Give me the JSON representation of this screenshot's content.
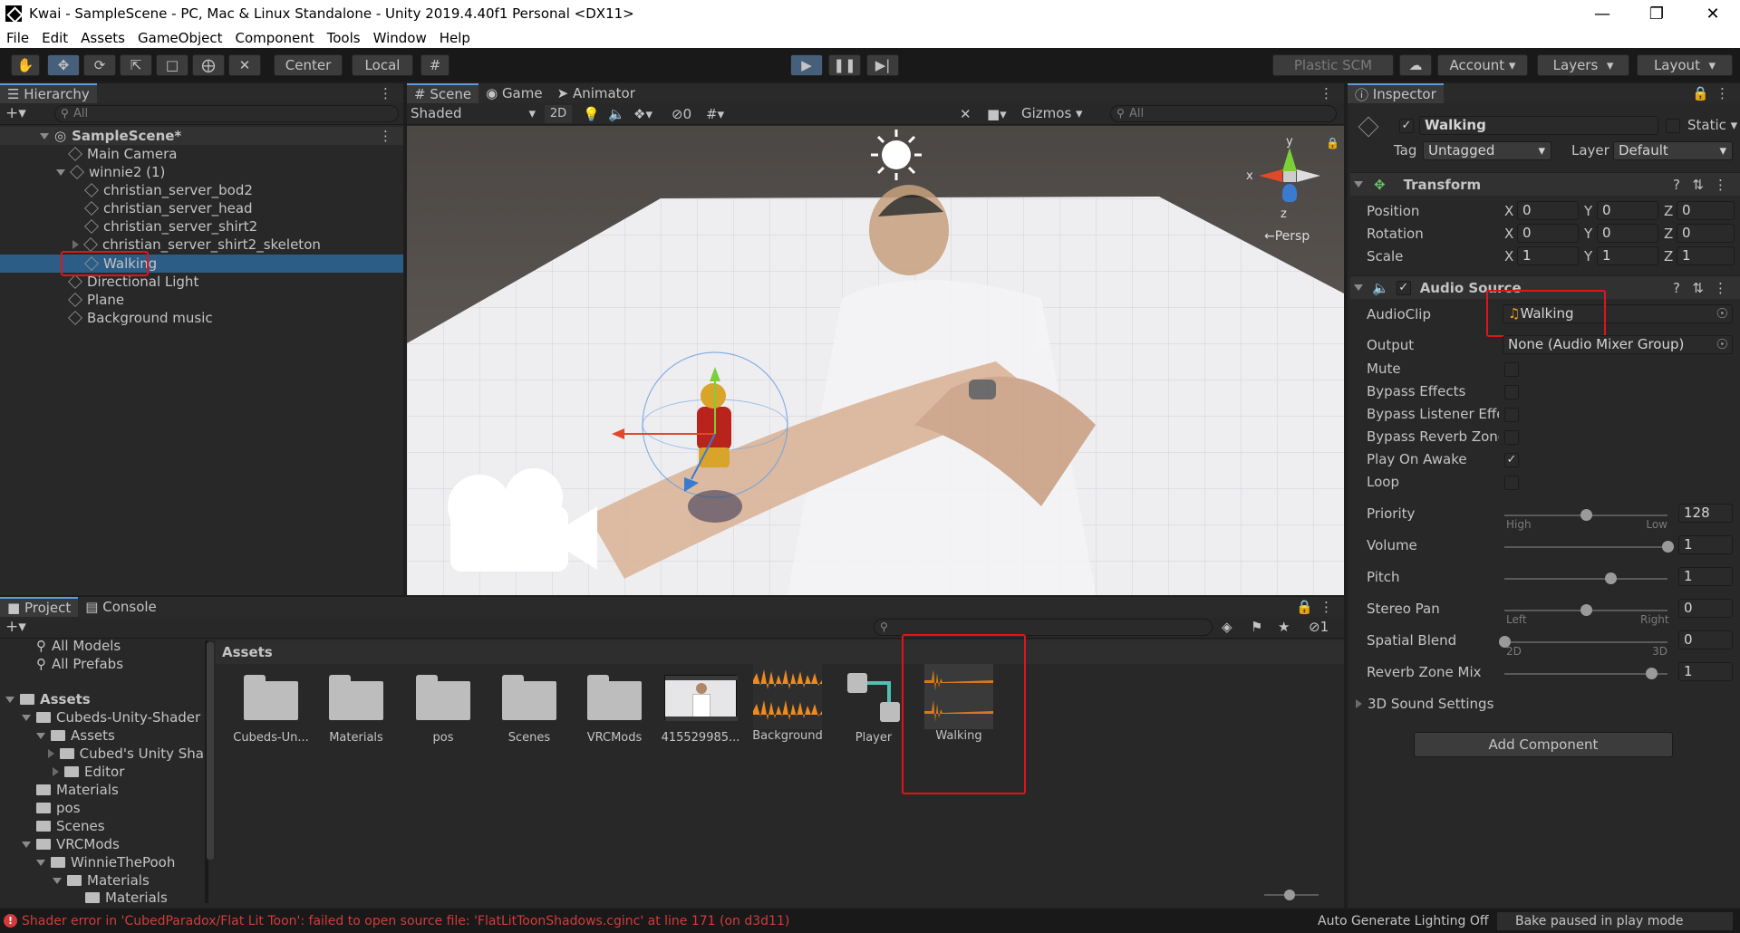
{
  "window": {
    "title": "Kwai - SampleScene - PC, Mac & Linux Standalone - Unity 2019.4.40f1 Personal <DX11>"
  },
  "menu": [
    "File",
    "Edit",
    "Assets",
    "GameObject",
    "Component",
    "Tools",
    "Window",
    "Help"
  ],
  "toolbar": {
    "pivot_label": "Center",
    "space_label": "Local",
    "plastic_label": "Plastic SCM",
    "account_label": "Account",
    "layers_label": "Layers",
    "layout_label": "Layout"
  },
  "hierarchy": {
    "tab_label": "Hierarchy",
    "search_placeholder": "All",
    "scene_name": "SampleScene*",
    "items": [
      {
        "label": "Main Camera"
      },
      {
        "label": "winnie2 (1)"
      },
      {
        "label": "christian_server_bod2"
      },
      {
        "label": "christian_server_head"
      },
      {
        "label": "christian_server_shirt2"
      },
      {
        "label": "christian_server_shirt2_skeleton"
      },
      {
        "label": "Walking"
      },
      {
        "label": "Directional Light"
      },
      {
        "label": "Plane"
      },
      {
        "label": "Background music"
      }
    ]
  },
  "scene": {
    "tabs": [
      "Scene",
      "Game",
      "Animator"
    ],
    "shading": "Shaded",
    "mode_2d": "2D",
    "hidden_count": "0",
    "gizmos_label": "Gizmos",
    "search_placeholder": "All",
    "projection": "←Persp",
    "axis_y": "y",
    "axis_x": "x",
    "axis_z": "z"
  },
  "project": {
    "tabs": [
      "Project",
      "Console"
    ],
    "tree": [
      {
        "label": "All Models"
      },
      {
        "label": "All Prefabs"
      },
      {
        "label": "Assets"
      },
      {
        "label": "Cubeds-Unity-Shader"
      },
      {
        "label": "Assets"
      },
      {
        "label": "Cubed's Unity Sha"
      },
      {
        "label": "Editor"
      },
      {
        "label": "Materials"
      },
      {
        "label": "pos"
      },
      {
        "label": "Scenes"
      },
      {
        "label": "VRCMods"
      },
      {
        "label": "WinnieThePooh"
      },
      {
        "label": "Materials"
      },
      {
        "label": "Materials"
      }
    ],
    "breadcrumb": "Assets",
    "hidden_count": "1",
    "assets": [
      {
        "label": "Cubeds-Un...",
        "kind": "folder"
      },
      {
        "label": "Materials",
        "kind": "folder"
      },
      {
        "label": "pos",
        "kind": "folder"
      },
      {
        "label": "Scenes",
        "kind": "folder"
      },
      {
        "label": "VRCMods",
        "kind": "folder"
      },
      {
        "label": "415529985...",
        "kind": "image"
      },
      {
        "label": "Background",
        "kind": "audio"
      },
      {
        "label": "Player",
        "kind": "prefab"
      },
      {
        "label": "Walking",
        "kind": "audio"
      }
    ]
  },
  "inspector": {
    "tab_label": "Inspector",
    "object_name": "Walking",
    "static_label": "Static",
    "tag_label": "Tag",
    "tag_value": "Untagged",
    "layer_label": "Layer",
    "layer_value": "Default",
    "transform": {
      "title": "Transform",
      "rows": [
        {
          "label": "Position",
          "x": "0",
          "y": "0",
          "z": "0"
        },
        {
          "label": "Rotation",
          "x": "0",
          "y": "0",
          "z": "0"
        },
        {
          "label": "Scale",
          "x": "1",
          "y": "1",
          "z": "1"
        }
      ]
    },
    "audio_source": {
      "title": "Audio Source",
      "audioclip_label": "AudioClip",
      "audioclip_value": "Walking",
      "output_label": "Output",
      "output_value": "None (Audio Mixer Group)",
      "toggles": [
        {
          "label": "Mute",
          "checked": false
        },
        {
          "label": "Bypass Effects",
          "checked": false
        },
        {
          "label": "Bypass Listener Effec",
          "checked": false
        },
        {
          "label": "Bypass Reverb Zones",
          "checked": false
        },
        {
          "label": "Play On Awake",
          "checked": true
        },
        {
          "label": "Loop",
          "checked": false
        }
      ],
      "check_mark": "✓",
      "sliders": [
        {
          "label": "Priority",
          "value": "128",
          "fraction": 0.5,
          "min_label": "High",
          "max_label": "Low"
        },
        {
          "label": "Volume",
          "value": "1",
          "fraction": 1.0,
          "min_label": "",
          "max_label": ""
        },
        {
          "label": "Pitch",
          "value": "1",
          "fraction": 0.65,
          "min_label": "",
          "max_label": ""
        },
        {
          "label": "Stereo Pan",
          "value": "0",
          "fraction": 0.5,
          "min_label": "Left",
          "max_label": "Right"
        },
        {
          "label": "Spatial Blend",
          "value": "0",
          "fraction": 0.0,
          "min_label": "2D",
          "max_label": "3D"
        },
        {
          "label": "Reverb Zone Mix",
          "value": "1",
          "fraction": 0.9,
          "min_label": "",
          "max_label": ""
        }
      ],
      "sound3d_label": "3D Sound Settings"
    },
    "add_component_label": "Add Component"
  },
  "statusbar": {
    "error_text": "Shader error in 'CubedParadox/Flat Lit Toon': failed to open source file: 'FlatLitToonShadows.cginc' at line 171 (on d3d11)",
    "lighting_text": "Auto Generate Lighting Off",
    "bake_text": "Bake paused in play mode"
  },
  "colors": {
    "selection": "#2c5d87",
    "highlight_box": "#e0141c",
    "error": "#d33b3b",
    "audio_wave": "#f08a1c"
  }
}
